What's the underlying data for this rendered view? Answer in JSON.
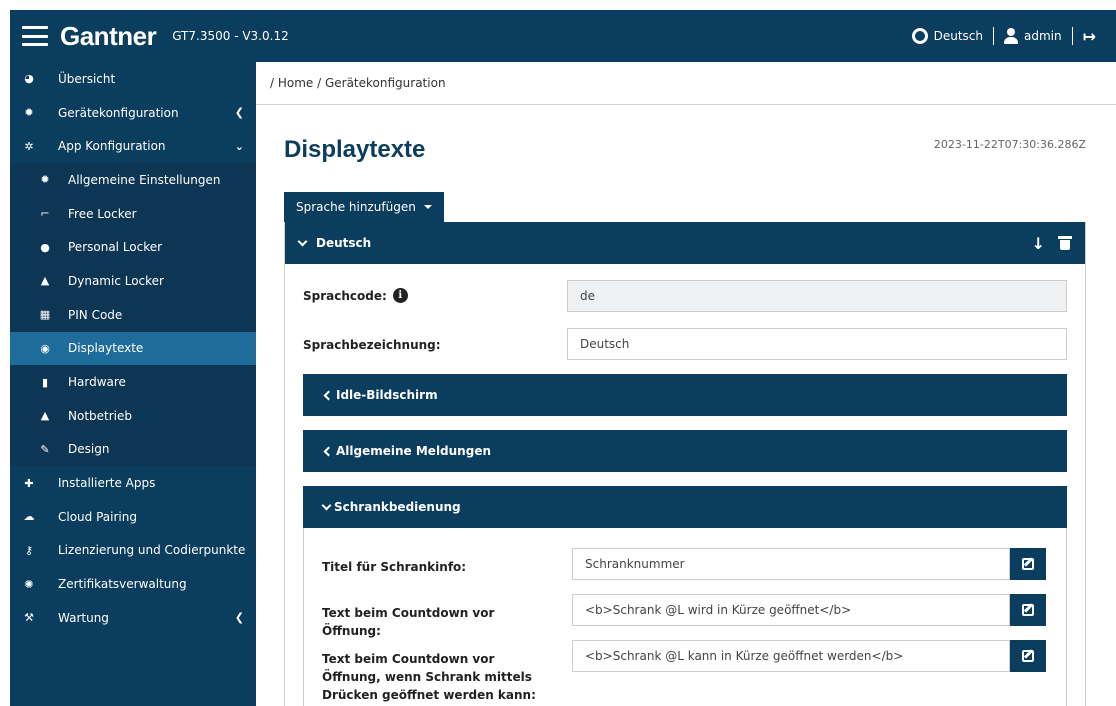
{
  "header": {
    "brand": "Gantner",
    "version": "GT7.3500 - V3.0.12",
    "language": "Deutsch",
    "user": "admin"
  },
  "sidebar": {
    "items": [
      {
        "label": "Übersicht",
        "icon": "pie-chart-icon"
      },
      {
        "label": "Gerätekonfiguration",
        "icon": "gear-icon"
      },
      {
        "label": "App Konfiguration",
        "icon": "gears-icon"
      },
      {
        "label": "Installierte Apps",
        "icon": "puzzle-icon"
      },
      {
        "label": "Cloud Pairing",
        "icon": "cloud-icon"
      },
      {
        "label": "Lizenzierung und Codierpunkte",
        "icon": "key-icon"
      },
      {
        "label": "Zertifikatsverwaltung",
        "icon": "certificate-icon"
      },
      {
        "label": "Wartung",
        "icon": "wrench-icon"
      }
    ],
    "sub_items": [
      {
        "label": "Allgemeine Einstellungen",
        "icon": "gear-icon"
      },
      {
        "label": "Free Locker",
        "icon": "unlock-icon"
      },
      {
        "label": "Personal Locker",
        "icon": "user-icon"
      },
      {
        "label": "Dynamic Locker",
        "icon": "lock-icon"
      },
      {
        "label": "PIN Code",
        "icon": "keypad-icon"
      },
      {
        "label": "Displaytexte",
        "icon": "globe-icon"
      },
      {
        "label": "Hardware",
        "icon": "chip-icon"
      },
      {
        "label": "Notbetrieb",
        "icon": "warning-icon"
      },
      {
        "label": "Design",
        "icon": "brush-icon"
      }
    ]
  },
  "breadcrumb": "/ Home / Gerätekonfiguration",
  "page": {
    "title": "Displaytexte",
    "timestamp": "2023-11-22T07:30:36.286Z",
    "add_language_label": "Sprache hinzufügen"
  },
  "language_panel": {
    "title": "Deutsch",
    "code_label": "Sprachcode:",
    "code_value": "de",
    "name_label": "Sprachbezeichnung:",
    "name_value": "Deutsch",
    "sections": {
      "idle": "Idle-Bildschirm",
      "messages": "Allgemeine Meldungen",
      "locker": "Schrankbedienung"
    },
    "locker_fields": [
      {
        "label": "Titel für Schrankinfo:",
        "value": "Schranknummer"
      },
      {
        "label": "Text beim Countdown vor Öffnung:",
        "value": "<b>Schrank @L wird in Kürze geöffnet</b>"
      },
      {
        "label": "Text beim Countdown vor Öffnung, wenn Schrank mittels Drücken geöffnet werden kann:",
        "value": "<b>Schrank @L kann in Kürze geöffnet werden</b>"
      }
    ]
  }
}
